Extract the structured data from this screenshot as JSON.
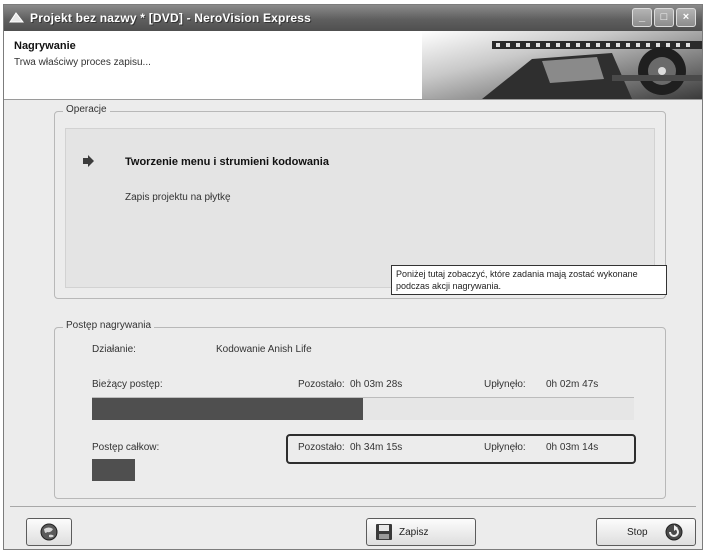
{
  "window": {
    "title": "Projekt bez nazwy * [DVD] - NeroVision Express"
  },
  "header": {
    "title": "Nagrywanie",
    "subtitle": "Trwa właściwy proces zapisu..."
  },
  "operations": {
    "legend": "Operacje",
    "current": "Tworzenie menu i strumieni kodowania",
    "next": "Zapis projektu na płytkę",
    "note": "Poniżej tutaj zobaczyć, które zadania mają zostać wykonane podczas akcji nagrywania."
  },
  "progress": {
    "legend": "Postęp nagrywania",
    "action_label": "Działanie:",
    "action_value": "Kodowanie Anish Life",
    "current": {
      "label": "Bieżący postęp:",
      "remaining_label": "Pozostało:",
      "remaining_value": "0h 03m 28s",
      "elapsed_label": "Upłynęło:",
      "elapsed_value": "0h 02m 47s",
      "fraction": 0.5
    },
    "total": {
      "label": "Postęp całkow:",
      "remaining_label": "Pozostało:",
      "remaining_value": "0h 34m 15s",
      "elapsed_label": "Upłynęło:",
      "elapsed_value": "0h 03m 14s",
      "fraction": 0.08
    }
  },
  "buttons": {
    "save_label": "Zapisz",
    "stop_label": "Stop"
  },
  "icons": {
    "app": "nero-app-icon",
    "help": "globe-help-icon",
    "save": "floppy-disk-icon",
    "stop": "stop-icon",
    "current_step": "arrow-right-icon"
  }
}
